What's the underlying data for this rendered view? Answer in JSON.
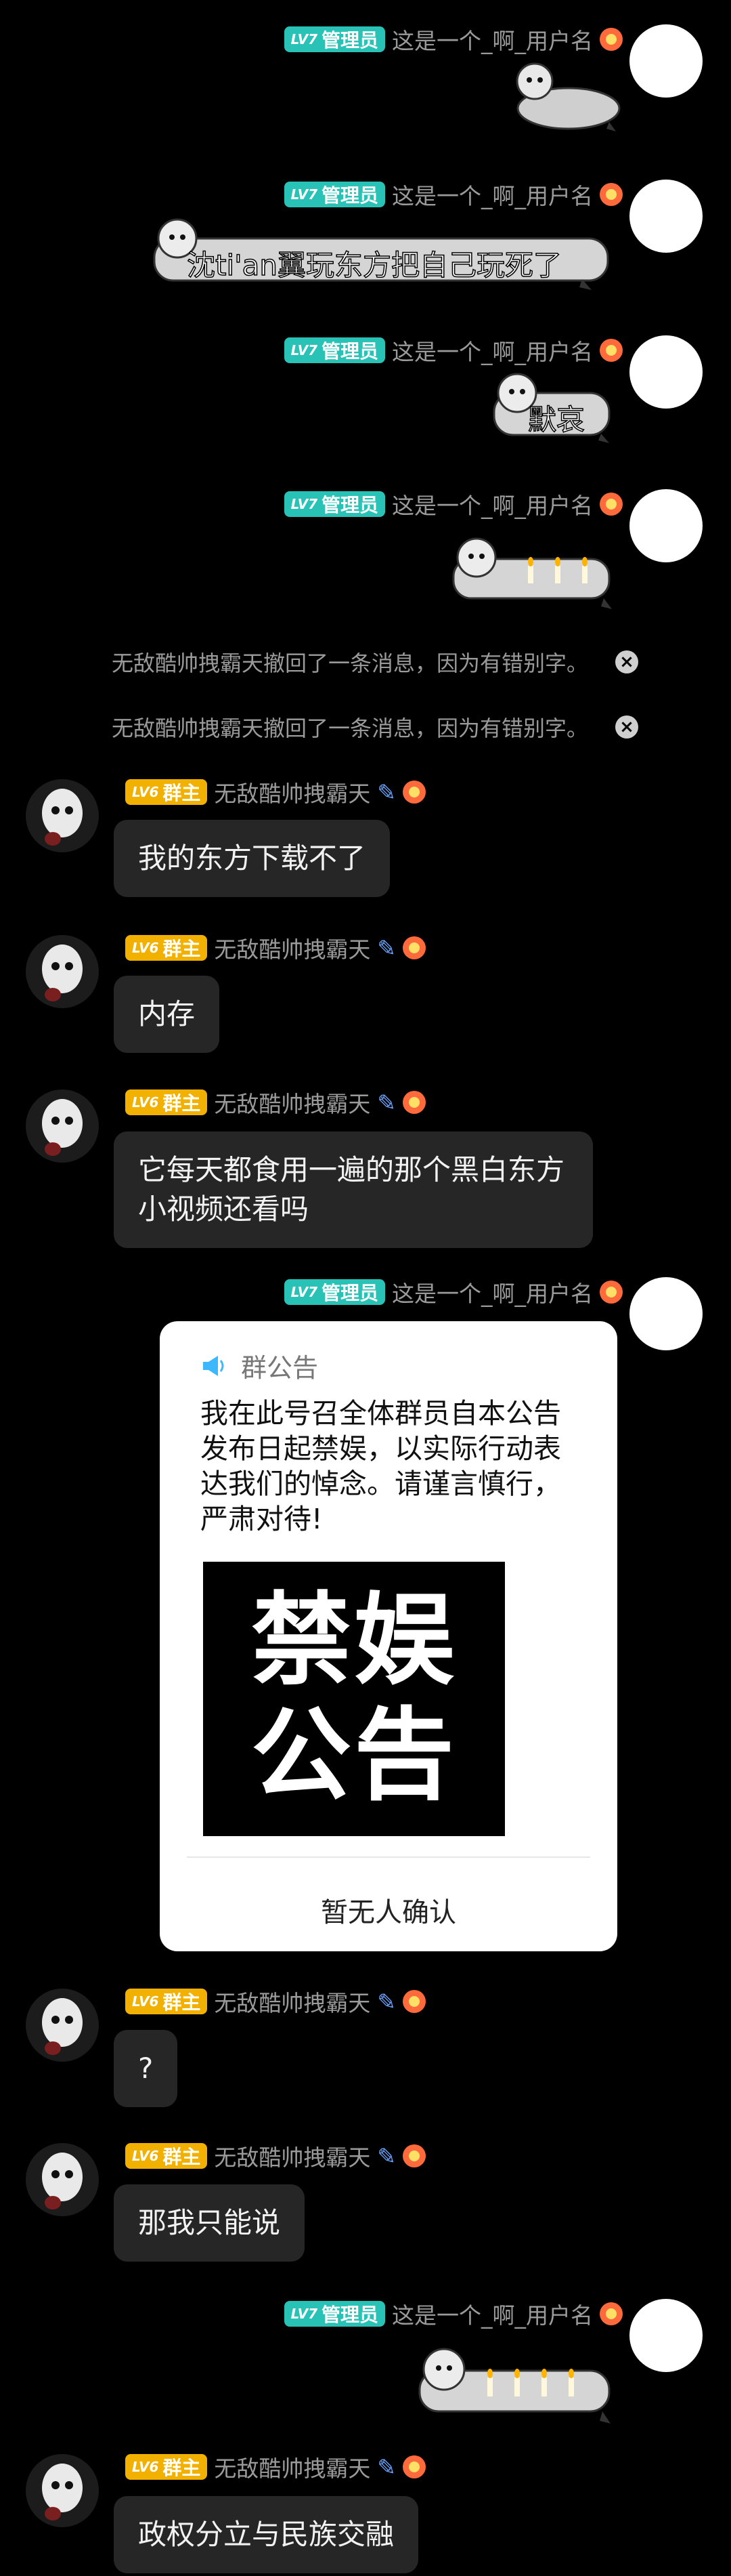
{
  "users": {
    "admin": {
      "level": "LV7",
      "role": "管理员",
      "name": "这是一个_啊_用户名"
    },
    "owner": {
      "level": "LV6",
      "role": "群主",
      "name": "无敌酷帅拽霸天"
    }
  },
  "messages": {
    "m2_sticker_text": "沈ti'an翼玩东方把自己玩死了",
    "m3_sticker_text": "默哀",
    "recall_1": "无敌酷帅拽霸天撤回了一条消息，因为有错别字。",
    "recall_2": "无敌酷帅拽霸天撤回了一条消息，因为有错别字。",
    "m5": "我的东方下载不了",
    "m6": "内存",
    "m7": "它每天都食用一遍的那个黑白东方小视频还看吗",
    "m9": "?",
    "m10": "那我只能说",
    "m12": "政权分立与民族交融"
  },
  "announcement": {
    "header": "群公告",
    "body": "我在此号召全体群员自本公告发布日起禁娱，以实际行动表达我们的悼念。请谨言慎行，严肃对待!",
    "image_line1": "禁娱",
    "image_line2": "公告",
    "footer": "暂无人确认"
  },
  "colors": {
    "background": "#000000",
    "bubble": "#262626",
    "admin_badge": "#29c2b7",
    "owner_badge": "#f2b100",
    "card": "#ffffff"
  }
}
